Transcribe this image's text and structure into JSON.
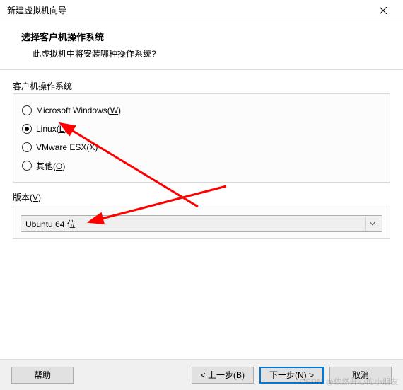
{
  "window": {
    "title": "新建虚拟机向导"
  },
  "header": {
    "title": "选择客户机操作系统",
    "subtitle": "此虚拟机中将安装哪种操作系统?"
  },
  "os_group": {
    "label": "客户机操作系统",
    "options": [
      {
        "label_prefix": "Microsoft Windows(",
        "mnemonic": "W",
        "label_suffix": ")",
        "selected": false
      },
      {
        "label_prefix": "Linux(",
        "mnemonic": "L",
        "label_suffix": ")",
        "selected": true
      },
      {
        "label_prefix": "VMware ESX(",
        "mnemonic": "X",
        "label_suffix": ")",
        "selected": false
      },
      {
        "label_prefix": "其他(",
        "mnemonic": "O",
        "label_suffix": ")",
        "selected": false
      }
    ]
  },
  "version_group": {
    "label_prefix": "版本(",
    "mnemonic": "V",
    "label_suffix": ")",
    "selected": "Ubuntu 64 位"
  },
  "buttons": {
    "help": "帮助",
    "back_prefix": "< 上一步(",
    "back_mnemonic": "B",
    "back_suffix": ")",
    "next_prefix": "下一步(",
    "next_mnemonic": "N",
    "next_suffix": ") >",
    "cancel": "取消"
  },
  "watermark": "CSDN @依然开心的小朋友"
}
